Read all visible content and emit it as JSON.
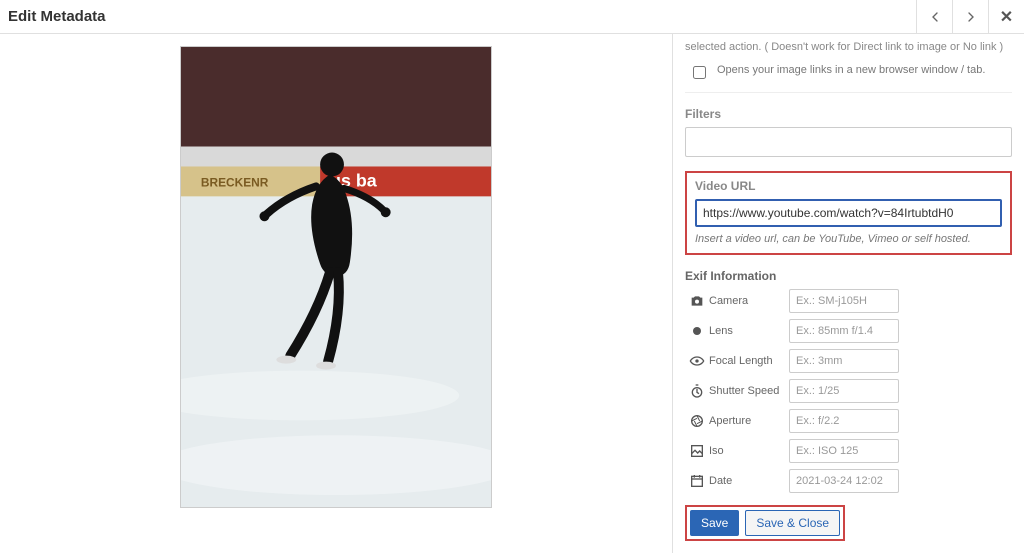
{
  "header": {
    "title": "Edit Metadata"
  },
  "hint_top": "selected action. ( Doesn't work for Direct link to image or No link )",
  "checkbox_label": "Opens your image links in a new browser window / tab.",
  "filters": {
    "label": "Filters",
    "value": ""
  },
  "video": {
    "label": "Video URL",
    "value": "https://www.youtube.com/watch?v=84IrtubtdH0",
    "hint": "Insert a video url, can be YouTube, Vimeo or self hosted."
  },
  "exif": {
    "title": "Exif Information",
    "fields": {
      "camera": {
        "label": "Camera",
        "placeholder": "Ex.: SM-j105H",
        "value": ""
      },
      "lens": {
        "label": "Lens",
        "placeholder": "Ex.: 85mm f/1.4",
        "value": ""
      },
      "focal_length": {
        "label": "Focal Length",
        "placeholder": "Ex.: 3mm",
        "value": ""
      },
      "shutter": {
        "label": "Shutter Speed",
        "placeholder": "Ex.: 1/25",
        "value": ""
      },
      "aperture": {
        "label": "Aperture",
        "placeholder": "Ex.: f/2.2",
        "value": ""
      },
      "iso": {
        "label": "Iso",
        "placeholder": "Ex.: ISO 125",
        "value": ""
      },
      "date": {
        "label": "Date",
        "placeholder": "2021-03-24 12:02",
        "value": ""
      }
    }
  },
  "buttons": {
    "save": "Save",
    "save_close": "Save & Close"
  }
}
